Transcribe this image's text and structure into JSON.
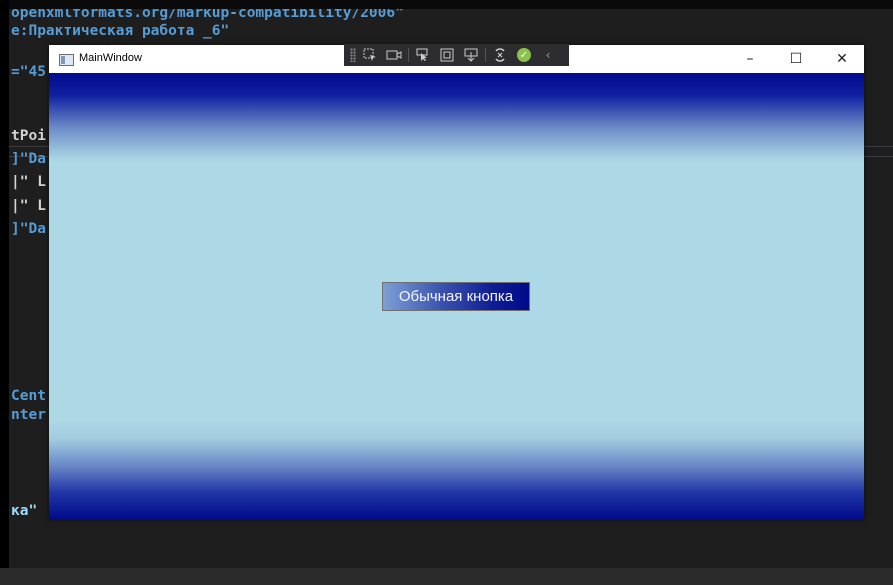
{
  "editor": {
    "lines": [
      "openxmlformats.org/markup-compatibility/2006\"",
      "e:Практическая работа _6\"",
      "=\"45",
      "tPoi",
      "]\"Da",
      "|\" L",
      "|\" L",
      "]\"Da",
      "Cent",
      "nter",
      "ка\""
    ]
  },
  "window": {
    "title": "MainWindow",
    "minimize": "–",
    "maximize": "☐",
    "close": "✕"
  },
  "debug_toolbar": {
    "icons": [
      "select-element-icon",
      "camera-icon",
      "pointer-icon",
      "layout-adorner-icon",
      "track-focus-icon",
      "hot-reload-icon",
      "check-icon",
      "collapse-icon"
    ],
    "collapse_glyph": "‹",
    "check_glyph": "✓"
  },
  "content": {
    "button_label": "Обычная кнопка"
  },
  "colors": {
    "gradient_edge": "#000b8c",
    "background_center": "#add8e6",
    "code_blue": "#569cd6"
  }
}
